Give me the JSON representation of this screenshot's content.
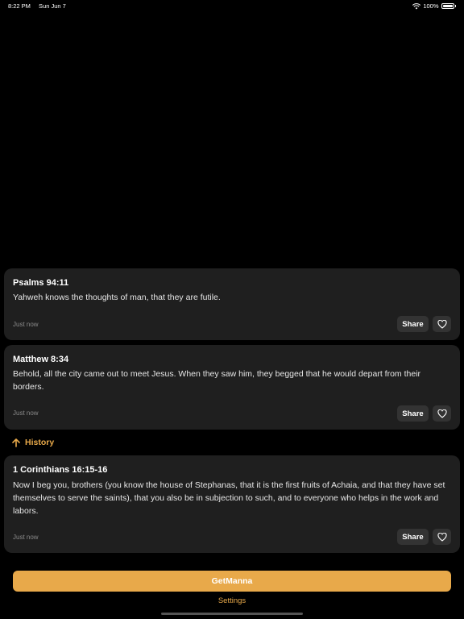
{
  "status": {
    "time": "8:22 PM",
    "date": "Sun Jun 7",
    "battery": "100%"
  },
  "verses": [
    {
      "reference": "Psalms 94:11",
      "text": "Yahweh knows the thoughts of man, that they are futile.",
      "time": "Just now",
      "share": "Share"
    },
    {
      "reference": "Matthew 8:34",
      "text": "Behold, all the city came out to meet Jesus. When they saw him, they begged that he would depart from their borders.",
      "time": "Just now",
      "share": "Share"
    }
  ],
  "history": {
    "label": "History",
    "verse": {
      "reference": "1 Corinthians 16:15-16",
      "text": "Now I beg you, brothers (you know the house of Stephanas, that it is the first fruits of Achaia, and that they have set themselves to serve the saints), that you also be in subjection to such, and to everyone who helps in the work and labors.",
      "time": "Just now",
      "share": "Share"
    }
  },
  "actions": {
    "primary": "GetManna",
    "settings": "Settings"
  },
  "colors": {
    "accent": "#e8a94a",
    "card": "#1f1f1f",
    "button": "#333333"
  },
  "icons": {
    "favorite": "heart-icon",
    "history": "arrow-up-icon",
    "wifi": "wifi-icon",
    "battery": "battery-icon"
  }
}
